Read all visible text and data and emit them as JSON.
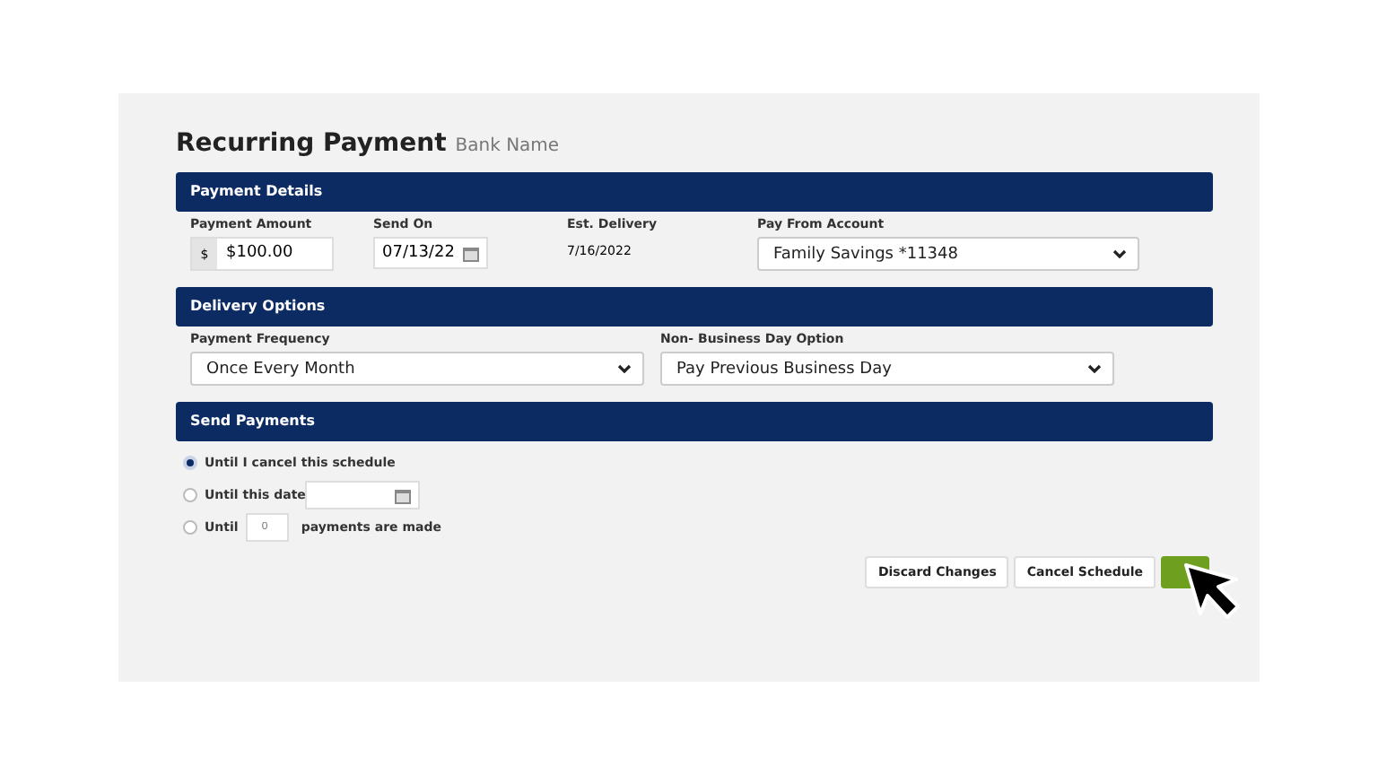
{
  "title": "Recurring Payment",
  "subtitle": "Bank Name",
  "payment_details": {
    "heading": "Payment Details",
    "amount_label": "Payment Amount",
    "currency": "$",
    "amount": "$100.00",
    "send_on_label": "Send On",
    "send_on": "07/13/22",
    "est_delivery_label": "Est. Delivery",
    "est_delivery": "7/16/2022",
    "account_label": "Pay From Account",
    "account": "Family Savings *11348"
  },
  "delivery_options": {
    "heading": "Delivery Options",
    "frequency_label": "Payment Frequency",
    "frequency": "Once Every Month",
    "non_business_label": "Non- Business Day Option",
    "non_business": "Pay Previous Business Day"
  },
  "send_payments": {
    "heading": "Send Payments",
    "options": [
      {
        "kind": "plain",
        "label": "Until I cancel this schedule",
        "selected": true
      },
      {
        "kind": "date",
        "label": "Until this date",
        "selected": false
      },
      {
        "kind": "count",
        "label": "Until",
        "after": "payments are made",
        "placeholder": "0",
        "selected": false
      }
    ]
  },
  "buttons": [
    {
      "kind": "outline",
      "label": "Discard Changes"
    },
    {
      "kind": "outline",
      "label": "Cancel Schedule"
    },
    {
      "kind": "primary"
    }
  ]
}
